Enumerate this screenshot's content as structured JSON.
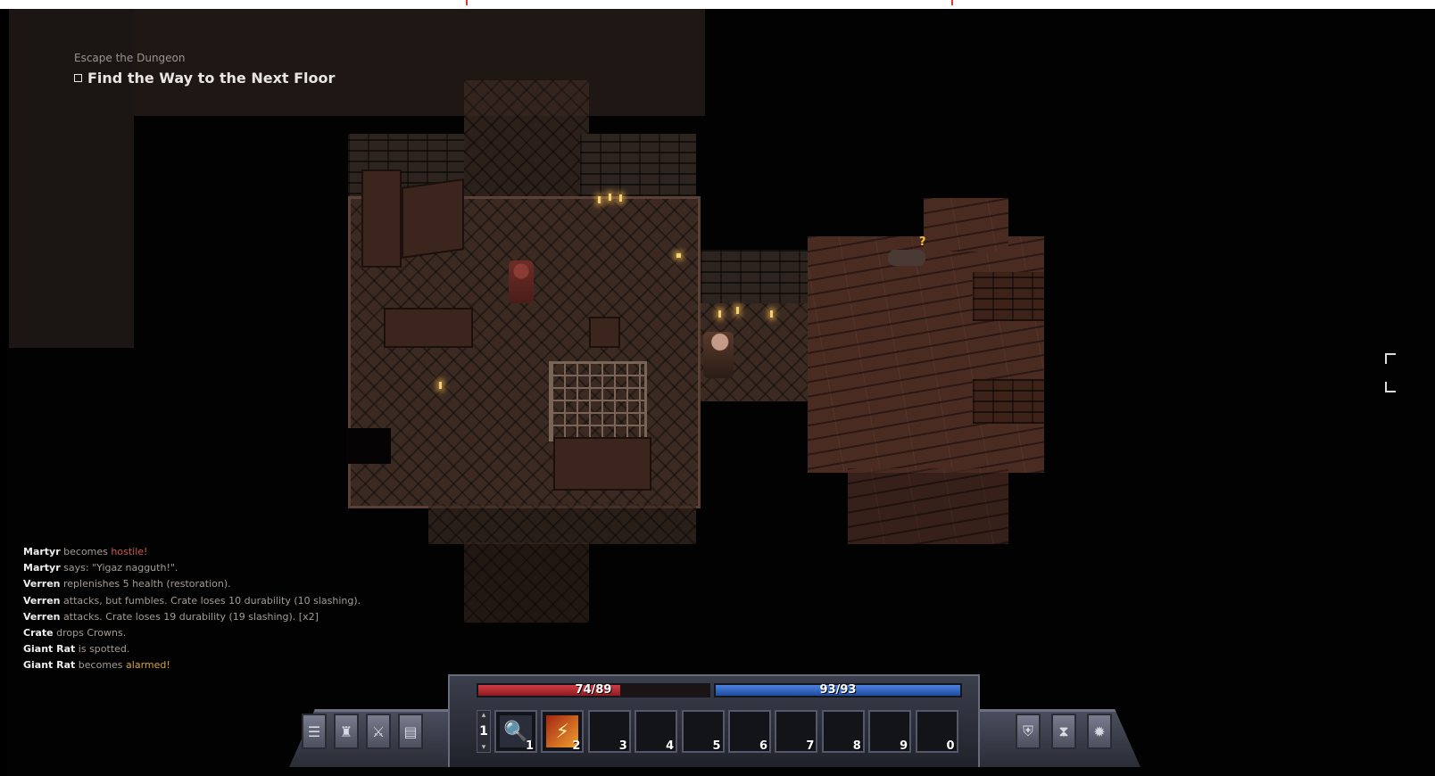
{
  "quest": {
    "title": "Escape the Dungeon",
    "objective": "Find the Way to the Next Floor"
  },
  "log": [
    {
      "actor": "Martyr",
      "text": " becomes ",
      "highlight": "hostile",
      "tail": "!"
    },
    {
      "actor": "Martyr",
      "text": " says: \"Yigaz nagguth!\".",
      "highlight": "",
      "tail": ""
    },
    {
      "actor": "Verren",
      "text": " replenishes 5 health (restoration).",
      "highlight": "",
      "tail": ""
    },
    {
      "actor": "Verren",
      "text": " attacks, but fumbles. Crate loses 10 durability (10 slashing).",
      "highlight": "",
      "tail": ""
    },
    {
      "actor": "Verren",
      "text": " attacks. Crate loses 19 durability (19 slashing). [x2]",
      "highlight": "",
      "tail": ""
    },
    {
      "actor": "Crate",
      "text": " drops Crowns.",
      "highlight": "",
      "tail": ""
    },
    {
      "actor": "Giant Rat",
      "text": " is spotted.",
      "highlight": "",
      "tail": ""
    },
    {
      "actor": "Giant Rat",
      "text": " becomes ",
      "highlight": "alarmed",
      "tail": "!"
    }
  ],
  "hud": {
    "health": {
      "current": 74,
      "max": 89,
      "label": "74/89"
    },
    "energy": {
      "current": 93,
      "max": 93,
      "label": "93/93"
    },
    "page_number": "1",
    "hotbar": [
      {
        "key": "1",
        "icon": "magnifier-icon"
      },
      {
        "key": "2",
        "icon": "fire-slash-icon"
      },
      {
        "key": "3",
        "icon": ""
      },
      {
        "key": "4",
        "icon": ""
      },
      {
        "key": "5",
        "icon": ""
      },
      {
        "key": "6",
        "icon": ""
      },
      {
        "key": "7",
        "icon": ""
      },
      {
        "key": "8",
        "icon": ""
      },
      {
        "key": "9",
        "icon": ""
      },
      {
        "key": "0",
        "icon": ""
      }
    ],
    "left_buttons": [
      "character-icon",
      "abilities-icon",
      "skills-icon",
      "journal-icon"
    ],
    "right_buttons": [
      "shield-icon",
      "hourglass-icon",
      "settings-icon"
    ]
  },
  "colors": {
    "health": "#b3242b",
    "energy": "#2c5fc0",
    "hostile": "#c95a4b",
    "alarmed": "#d6a437"
  }
}
